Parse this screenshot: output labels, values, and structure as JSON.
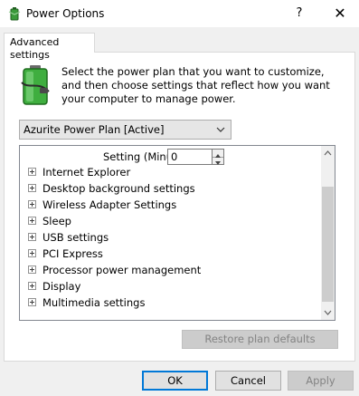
{
  "window": {
    "title": "Power Options",
    "help_glyph": "?",
    "close_glyph": "✕"
  },
  "tabs": [
    {
      "label": "Advanced settings"
    }
  ],
  "description": "Select the power plan that you want to customize, and then choose settings that reflect how you want your computer to manage power.",
  "plan_select": {
    "value": "Azurite Power Plan [Active]"
  },
  "setting": {
    "label": "Setting (Minutes):",
    "value": "0"
  },
  "tree_items": [
    {
      "label": "Internet Explorer"
    },
    {
      "label": "Desktop background settings"
    },
    {
      "label": "Wireless Adapter Settings"
    },
    {
      "label": "Sleep"
    },
    {
      "label": "USB settings"
    },
    {
      "label": "PCI Express"
    },
    {
      "label": "Processor power management"
    },
    {
      "label": "Display"
    },
    {
      "label": "Multimedia settings"
    }
  ],
  "buttons": {
    "restore": "Restore plan defaults",
    "ok": "OK",
    "cancel": "Cancel",
    "apply": "Apply"
  },
  "colors": {
    "focus_border": "#0078d7",
    "disabled_text": "#838383"
  }
}
